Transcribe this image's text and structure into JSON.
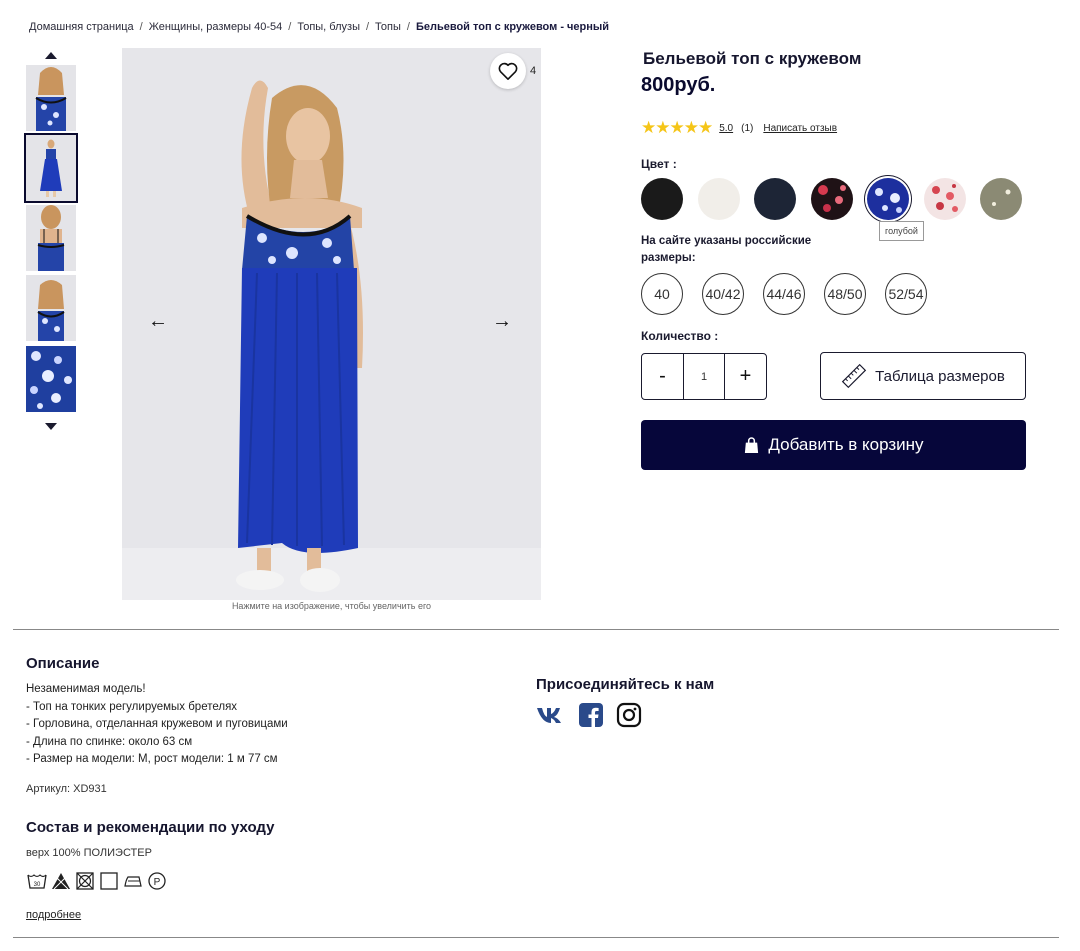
{
  "breadcrumb": {
    "items": [
      "Домашняя страница",
      "Женщины, размеры 40-54",
      "Топы, блузы",
      "Топы"
    ],
    "current": "Бельевой топ с кружевом - черный",
    "separator": "/"
  },
  "gallery": {
    "wishlist_count": "4",
    "zoom_hint": "Нажмите на изображение, чтобы увеличить его",
    "selected_thumb": 2
  },
  "product": {
    "title": "Бельевой топ с кружевом",
    "price": "800руб.",
    "rating": {
      "stars": "★★★★★",
      "value": "5.0",
      "count": "(1)",
      "write_review": "Написать отзыв"
    }
  },
  "color": {
    "label": "Цвет :",
    "tooltip": "голубой",
    "options": [
      "black",
      "cream",
      "navy",
      "black-floral",
      "blue-floral",
      "red-floral",
      "khaki"
    ],
    "colors": {
      "black": "#1a1a1a",
      "cream": "#f1eee9",
      "navy": "#1d2536",
      "blue": "#1d2f9e",
      "khaki": "#8b8a74"
    }
  },
  "sizes": {
    "note": "На сайте указаны российские размеры:",
    "options": [
      "40",
      "40/42",
      "44/46",
      "48/50",
      "52/54"
    ]
  },
  "quantity": {
    "label": "Количество :",
    "minus": "-",
    "plus": "+",
    "value": "1"
  },
  "actions": {
    "size_chart": "Таблица размеров",
    "add_to_cart": "Добавить в корзину",
    "brand_color": "#06063a"
  },
  "description": {
    "title": "Описание",
    "lines": [
      "Незаменимая модель!",
      "- Топ на тонких регулируемых бретелях",
      "- Горловина, отделанная кружевом и пуговицами",
      "- Длина по спинке: около 63 см",
      "- Размер на модели: M, рост модели: 1 м 77 см"
    ],
    "article": "Артикул: XD931"
  },
  "care": {
    "title": "Состав и рекомендации по уходу",
    "composition": "верх 100% ПОЛИЭСТЕР",
    "icons": [
      "wash-30-icon",
      "no-bleach-icon",
      "no-tumble-dry-icon",
      "dry-flat-icon",
      "iron-low-icon",
      "dry-clean-p-icon"
    ],
    "more": "подробнее"
  },
  "social": {
    "title": "Присоединяйтесь к нам",
    "icons": [
      "vk-icon",
      "facebook-icon",
      "instagram-icon"
    ],
    "color": "#2a4a8a"
  }
}
